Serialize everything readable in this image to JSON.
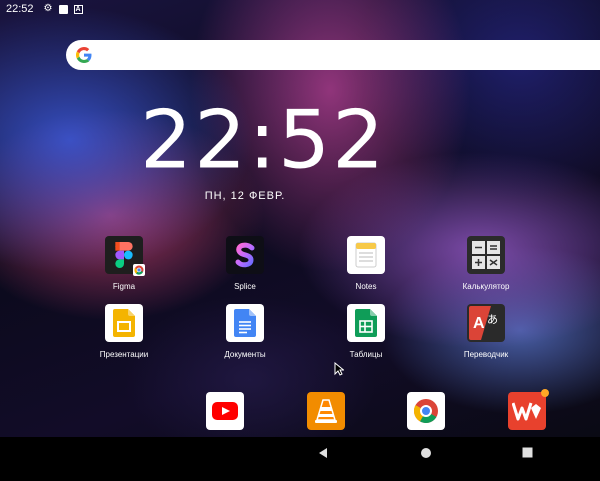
{
  "status_bar": {
    "time": "22:52",
    "icons": [
      "gear-icon",
      "square-icon",
      "a-box-icon"
    ]
  },
  "search": {
    "icon": "google-g-icon"
  },
  "clock": {
    "time": "22:52",
    "date": "ПН, 12 ФЕВР."
  },
  "apps": [
    {
      "label": "Figma"
    },
    {
      "label": "Splice"
    },
    {
      "label": "Notes"
    },
    {
      "label": "Калькулятор"
    },
    {
      "label": "Презентации"
    },
    {
      "label": "Документы"
    },
    {
      "label": "Таблицы"
    },
    {
      "label": "Переводчик"
    }
  ],
  "dock": [
    {
      "name": "youtube-icon"
    },
    {
      "name": "vlc-icon"
    },
    {
      "name": "chrome-icon"
    },
    {
      "name": "wps-office-icon"
    }
  ],
  "nav": [
    "back-icon",
    "home-icon",
    "recents-icon"
  ]
}
